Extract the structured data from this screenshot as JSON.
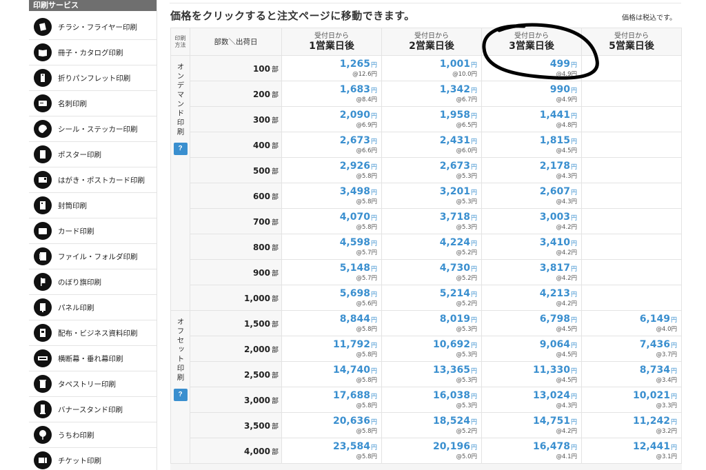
{
  "sidebar": {
    "title": "印刷サービス",
    "items": [
      {
        "label": "チラシ・フライヤー印刷",
        "icon": "flyer-icon"
      },
      {
        "label": "冊子・カタログ印刷",
        "icon": "booklet-icon"
      },
      {
        "label": "折りパンフレット印刷",
        "icon": "folded-pamphlet-icon"
      },
      {
        "label": "名刺印刷",
        "icon": "business-card-icon"
      },
      {
        "label": "シール・ステッカー印刷",
        "icon": "sticker-icon"
      },
      {
        "label": "ポスター印刷",
        "icon": "poster-icon"
      },
      {
        "label": "はがき・ポストカード印刷",
        "icon": "postcard-icon"
      },
      {
        "label": "封筒印刷",
        "icon": "envelope-icon"
      },
      {
        "label": "カード印刷",
        "icon": "card-icon"
      },
      {
        "label": "ファイル・フォルダ印刷",
        "icon": "file-folder-icon"
      },
      {
        "label": "のぼり旗印刷",
        "icon": "banner-flag-icon"
      },
      {
        "label": "パネル印刷",
        "icon": "panel-icon"
      },
      {
        "label": "配布・ビジネス資料印刷",
        "icon": "business-document-icon"
      },
      {
        "label": "横断幕・垂れ幕印刷",
        "icon": "hanging-banner-icon"
      },
      {
        "label": "タペストリー印刷",
        "icon": "tapestry-icon"
      },
      {
        "label": "バナースタンド印刷",
        "icon": "banner-stand-icon"
      },
      {
        "label": "うちわ印刷",
        "icon": "uchiwa-fan-icon"
      },
      {
        "label": "チケット印刷",
        "icon": "ticket-icon"
      }
    ]
  },
  "header": {
    "title": "価格をクリックすると注文ページに移動できます。",
    "tax_note": "価格は税込です。"
  },
  "table": {
    "method_header": "印刷方法",
    "qty_header": "部数＼出荷日",
    "delivery_columns": [
      {
        "top": "受付日から",
        "bottom": "1営業日後"
      },
      {
        "top": "受付日から",
        "bottom": "2営業日後"
      },
      {
        "top": "受付日から",
        "bottom": "3営業日後"
      },
      {
        "top": "受付日から",
        "bottom": "5営業日後"
      }
    ],
    "yen": "円",
    "qty_unit": "部",
    "groups": [
      {
        "method": "オンデマンド印刷",
        "help": "?",
        "rows": [
          {
            "qty": "100",
            "prices": [
              {
                "price": "1,265",
                "unit": "@12.6円"
              },
              {
                "price": "1,001",
                "unit": "@10.0円"
              },
              {
                "price": "499",
                "unit": "@4.9円"
              },
              null
            ]
          },
          {
            "qty": "200",
            "prices": [
              {
                "price": "1,683",
                "unit": "@8.4円"
              },
              {
                "price": "1,342",
                "unit": "@6.7円"
              },
              {
                "price": "990",
                "unit": "@4.9円"
              },
              null
            ]
          },
          {
            "qty": "300",
            "prices": [
              {
                "price": "2,090",
                "unit": "@6.9円"
              },
              {
                "price": "1,958",
                "unit": "@6.5円"
              },
              {
                "price": "1,441",
                "unit": "@4.8円"
              },
              null
            ]
          },
          {
            "qty": "400",
            "prices": [
              {
                "price": "2,673",
                "unit": "@6.6円"
              },
              {
                "price": "2,431",
                "unit": "@6.0円"
              },
              {
                "price": "1,815",
                "unit": "@4.5円"
              },
              null
            ]
          },
          {
            "qty": "500",
            "prices": [
              {
                "price": "2,926",
                "unit": "@5.8円"
              },
              {
                "price": "2,673",
                "unit": "@5.3円"
              },
              {
                "price": "2,178",
                "unit": "@4.3円"
              },
              null
            ]
          },
          {
            "qty": "600",
            "prices": [
              {
                "price": "3,498",
                "unit": "@5.8円"
              },
              {
                "price": "3,201",
                "unit": "@5.3円"
              },
              {
                "price": "2,607",
                "unit": "@4.3円"
              },
              null
            ]
          },
          {
            "qty": "700",
            "prices": [
              {
                "price": "4,070",
                "unit": "@5.8円"
              },
              {
                "price": "3,718",
                "unit": "@5.3円"
              },
              {
                "price": "3,003",
                "unit": "@4.2円"
              },
              null
            ]
          },
          {
            "qty": "800",
            "prices": [
              {
                "price": "4,598",
                "unit": "@5.7円"
              },
              {
                "price": "4,224",
                "unit": "@5.2円"
              },
              {
                "price": "3,410",
                "unit": "@4.2円"
              },
              null
            ]
          },
          {
            "qty": "900",
            "prices": [
              {
                "price": "5,148",
                "unit": "@5.7円"
              },
              {
                "price": "4,730",
                "unit": "@5.2円"
              },
              {
                "price": "3,817",
                "unit": "@4.2円"
              },
              null
            ]
          },
          {
            "qty": "1,000",
            "prices": [
              {
                "price": "5,698",
                "unit": "@5.6円"
              },
              {
                "price": "5,214",
                "unit": "@5.2円"
              },
              {
                "price": "4,213",
                "unit": "@4.2円"
              },
              null
            ]
          }
        ]
      },
      {
        "method": "オフセット印刷",
        "help": "?",
        "rows": [
          {
            "qty": "1,500",
            "prices": [
              {
                "price": "8,844",
                "unit": "@5.8円"
              },
              {
                "price": "8,019",
                "unit": "@5.3円"
              },
              {
                "price": "6,798",
                "unit": "@4.5円"
              },
              {
                "price": "6,149",
                "unit": "@4.0円"
              }
            ]
          },
          {
            "qty": "2,000",
            "prices": [
              {
                "price": "11,792",
                "unit": "@5.8円"
              },
              {
                "price": "10,692",
                "unit": "@5.3円"
              },
              {
                "price": "9,064",
                "unit": "@4.5円"
              },
              {
                "price": "7,436",
                "unit": "@3.7円"
              }
            ]
          },
          {
            "qty": "2,500",
            "prices": [
              {
                "price": "14,740",
                "unit": "@5.8円"
              },
              {
                "price": "13,365",
                "unit": "@5.3円"
              },
              {
                "price": "11,330",
                "unit": "@4.5円"
              },
              {
                "price": "8,734",
                "unit": "@3.4円"
              }
            ]
          },
          {
            "qty": "3,000",
            "prices": [
              {
                "price": "17,688",
                "unit": "@5.8円"
              },
              {
                "price": "16,038",
                "unit": "@5.3円"
              },
              {
                "price": "13,024",
                "unit": "@4.3円"
              },
              {
                "price": "10,021",
                "unit": "@3.3円"
              }
            ]
          },
          {
            "qty": "3,500",
            "prices": [
              {
                "price": "20,636",
                "unit": "@5.8円"
              },
              {
                "price": "18,524",
                "unit": "@5.2円"
              },
              {
                "price": "14,751",
                "unit": "@4.2円"
              },
              {
                "price": "11,242",
                "unit": "@3.2円"
              }
            ]
          },
          {
            "qty": "4,000",
            "prices": [
              {
                "price": "23,584",
                "unit": "@5.8円"
              },
              {
                "price": "20,196",
                "unit": "@5.0円"
              },
              {
                "price": "16,478",
                "unit": "@4.1円"
              },
              {
                "price": "12,441",
                "unit": "@3.1円"
              }
            ]
          }
        ]
      }
    ]
  }
}
